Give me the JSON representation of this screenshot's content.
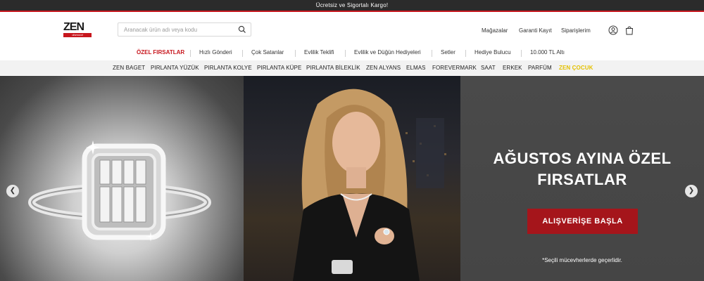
{
  "announcement": "Ücretsiz ve Sigortalı Kargo!",
  "logo": {
    "text": "ZEN",
    "sub": "diamond"
  },
  "search": {
    "placeholder": "Aranacak ürün adı veya kodu"
  },
  "header_links": [
    "Mağazalar",
    "Garanti Kayıt",
    "Siparişlerim"
  ],
  "header_icons": [
    "user-icon",
    "bag-icon"
  ],
  "primary_nav": [
    "ÖZEL FIRSATLAR",
    "Hızlı Gönderi",
    "Çok Satanlar",
    "Evlilik Teklifi",
    "Evlilik ve Düğün Hediyeleri",
    "Setler",
    "Hediye Bulucu",
    "10.000 TL Altı"
  ],
  "secondary_nav": [
    "ZEN BAGET",
    "PIRLANTA YÜZÜK",
    "PIRLANTA KOLYE",
    "PIRLANTA KÜPE",
    "PIRLANTA BİLEKLİK",
    "ZEN ALYANS",
    "ELMAS",
    "FOREVERMARK",
    "SAAT",
    "ERKEK",
    "PARFÜM",
    "ZEN ÇOCUK"
  ],
  "hero": {
    "title_line1": "AĞUSTOS AYINA ÖZEL",
    "title_line2": "FIRSATLAR",
    "button": "ALIŞVERİŞE BAŞLA",
    "note": "*Seçili mücevherlerde geçerlidir."
  },
  "colors": {
    "accent": "#c7161d",
    "button": "#a5151b",
    "kids": "#e4c100"
  }
}
